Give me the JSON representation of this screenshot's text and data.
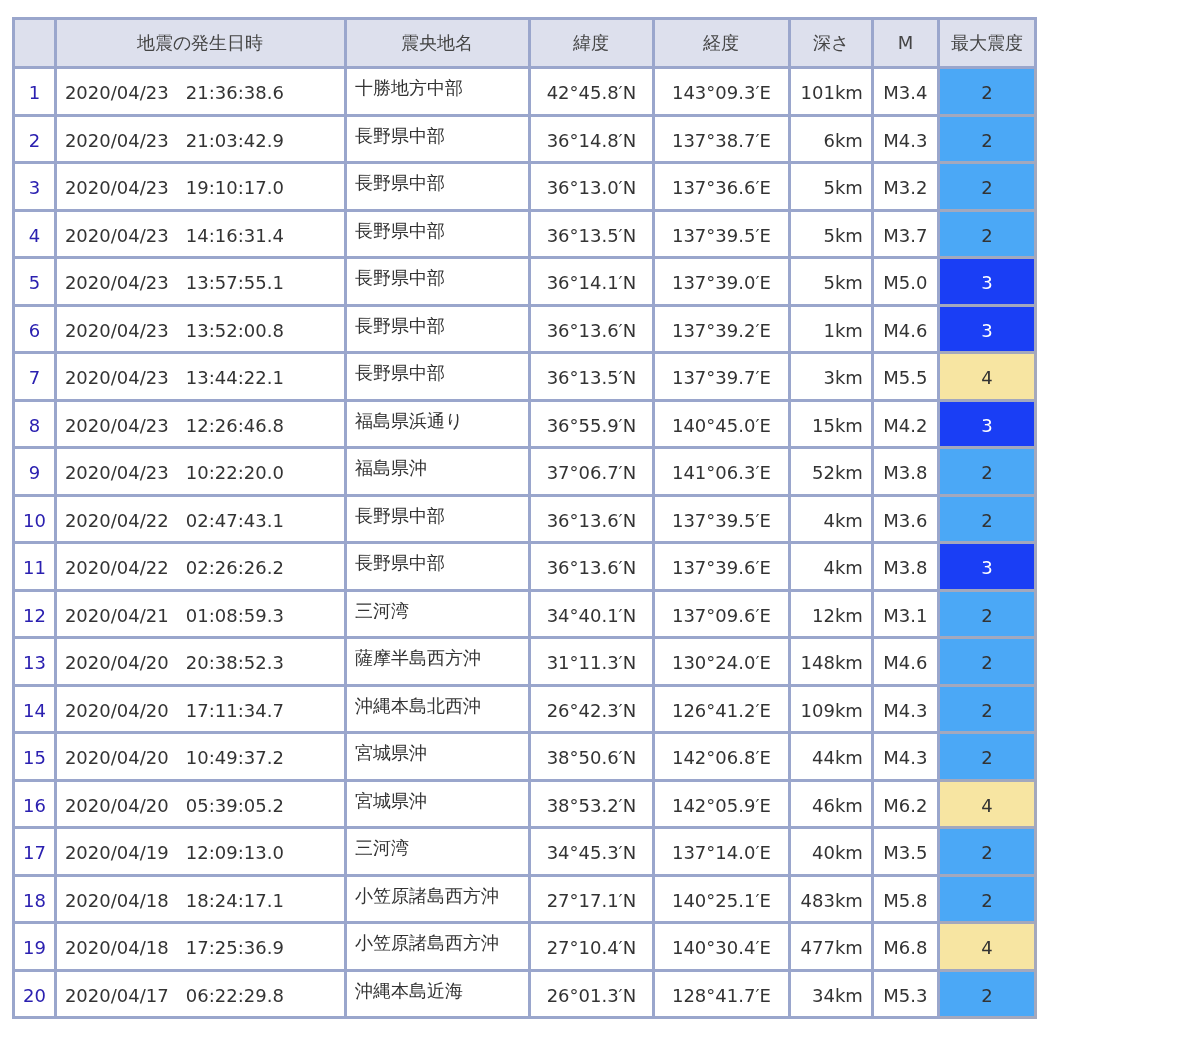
{
  "table": {
    "columns": [
      "",
      "地震の発生日時",
      "震央地名",
      "緯度",
      "経度",
      "深さ",
      "M",
      "最大震度"
    ],
    "rows": [
      {
        "no": "1",
        "datetime": "2020/04/23   21:36:38.6",
        "place": "十勝地方中部",
        "lat": "42°45.8′N",
        "lon": "143°09.3′E",
        "depth": "101km",
        "mag": "M3.4",
        "intensity": "2",
        "color": "#4ba8f6"
      },
      {
        "no": "2",
        "datetime": "2020/04/23   21:03:42.9",
        "place": "長野県中部",
        "lat": "36°14.8′N",
        "lon": "137°38.7′E",
        "depth": "6km",
        "mag": "M4.3",
        "intensity": "2",
        "color": "#4ba8f6"
      },
      {
        "no": "3",
        "datetime": "2020/04/23   19:10:17.0",
        "place": "長野県中部",
        "lat": "36°13.0′N",
        "lon": "137°36.6′E",
        "depth": "5km",
        "mag": "M3.2",
        "intensity": "2",
        "color": "#4ba8f6"
      },
      {
        "no": "4",
        "datetime": "2020/04/23   14:16:31.4",
        "place": "長野県中部",
        "lat": "36°13.5′N",
        "lon": "137°39.5′E",
        "depth": "5km",
        "mag": "M3.7",
        "intensity": "2",
        "color": "#4ba8f6"
      },
      {
        "no": "5",
        "datetime": "2020/04/23   13:57:55.1",
        "place": "長野県中部",
        "lat": "36°14.1′N",
        "lon": "137°39.0′E",
        "depth": "5km",
        "mag": "M5.0",
        "intensity": "3",
        "color": "#1a3ef5"
      },
      {
        "no": "6",
        "datetime": "2020/04/23   13:52:00.8",
        "place": "長野県中部",
        "lat": "36°13.6′N",
        "lon": "137°39.2′E",
        "depth": "1km",
        "mag": "M4.6",
        "intensity": "3",
        "color": "#1a3ef5"
      },
      {
        "no": "7",
        "datetime": "2020/04/23   13:44:22.1",
        "place": "長野県中部",
        "lat": "36°13.5′N",
        "lon": "137°39.7′E",
        "depth": "3km",
        "mag": "M5.5",
        "intensity": "4",
        "color": "#f7e5a2"
      },
      {
        "no": "8",
        "datetime": "2020/04/23   12:26:46.8",
        "place": "福島県浜通り",
        "lat": "36°55.9′N",
        "lon": "140°45.0′E",
        "depth": "15km",
        "mag": "M4.2",
        "intensity": "3",
        "color": "#1a3ef5"
      },
      {
        "no": "9",
        "datetime": "2020/04/23   10:22:20.0",
        "place": "福島県沖",
        "lat": "37°06.7′N",
        "lon": "141°06.3′E",
        "depth": "52km",
        "mag": "M3.8",
        "intensity": "2",
        "color": "#4ba8f6"
      },
      {
        "no": "10",
        "datetime": "2020/04/22   02:47:43.1",
        "place": "長野県中部",
        "lat": "36°13.6′N",
        "lon": "137°39.5′E",
        "depth": "4km",
        "mag": "M3.6",
        "intensity": "2",
        "color": "#4ba8f6"
      },
      {
        "no": "11",
        "datetime": "2020/04/22   02:26:26.2",
        "place": "長野県中部",
        "lat": "36°13.6′N",
        "lon": "137°39.6′E",
        "depth": "4km",
        "mag": "M3.8",
        "intensity": "3",
        "color": "#1a3ef5"
      },
      {
        "no": "12",
        "datetime": "2020/04/21   01:08:59.3",
        "place": "三河湾",
        "lat": "34°40.1′N",
        "lon": "137°09.6′E",
        "depth": "12km",
        "mag": "M3.1",
        "intensity": "2",
        "color": "#4ba8f6"
      },
      {
        "no": "13",
        "datetime": "2020/04/20   20:38:52.3",
        "place": "薩摩半島西方沖",
        "lat": "31°11.3′N",
        "lon": "130°24.0′E",
        "depth": "148km",
        "mag": "M4.6",
        "intensity": "2",
        "color": "#4ba8f6"
      },
      {
        "no": "14",
        "datetime": "2020/04/20   17:11:34.7",
        "place": "沖縄本島北西沖",
        "lat": "26°42.3′N",
        "lon": "126°41.2′E",
        "depth": "109km",
        "mag": "M4.3",
        "intensity": "2",
        "color": "#4ba8f6"
      },
      {
        "no": "15",
        "datetime": "2020/04/20   10:49:37.2",
        "place": "宮城県沖",
        "lat": "38°50.6′N",
        "lon": "142°06.8′E",
        "depth": "44km",
        "mag": "M4.3",
        "intensity": "2",
        "color": "#4ba8f6"
      },
      {
        "no": "16",
        "datetime": "2020/04/20   05:39:05.2",
        "place": "宮城県沖",
        "lat": "38°53.2′N",
        "lon": "142°05.9′E",
        "depth": "46km",
        "mag": "M6.2",
        "intensity": "4",
        "color": "#f7e5a2"
      },
      {
        "no": "17",
        "datetime": "2020/04/19   12:09:13.0",
        "place": "三河湾",
        "lat": "34°45.3′N",
        "lon": "137°14.0′E",
        "depth": "40km",
        "mag": "M3.5",
        "intensity": "2",
        "color": "#4ba8f6"
      },
      {
        "no": "18",
        "datetime": "2020/04/18   18:24:17.1",
        "place": "小笠原諸島西方沖",
        "lat": "27°17.1′N",
        "lon": "140°25.1′E",
        "depth": "483km",
        "mag": "M5.8",
        "intensity": "2",
        "color": "#4ba8f6"
      },
      {
        "no": "19",
        "datetime": "2020/04/18   17:25:36.9",
        "place": "小笠原諸島西方沖",
        "lat": "27°10.4′N",
        "lon": "140°30.4′E",
        "depth": "477km",
        "mag": "M6.8",
        "intensity": "4",
        "color": "#f7e5a2"
      },
      {
        "no": "20",
        "datetime": "2020/04/17   06:22:29.8",
        "place": "沖縄本島近海",
        "lat": "26°01.3′N",
        "lon": "128°41.7′E",
        "depth": "34km",
        "mag": "M5.3",
        "intensity": "2",
        "color": "#4ba8f6"
      }
    ]
  }
}
